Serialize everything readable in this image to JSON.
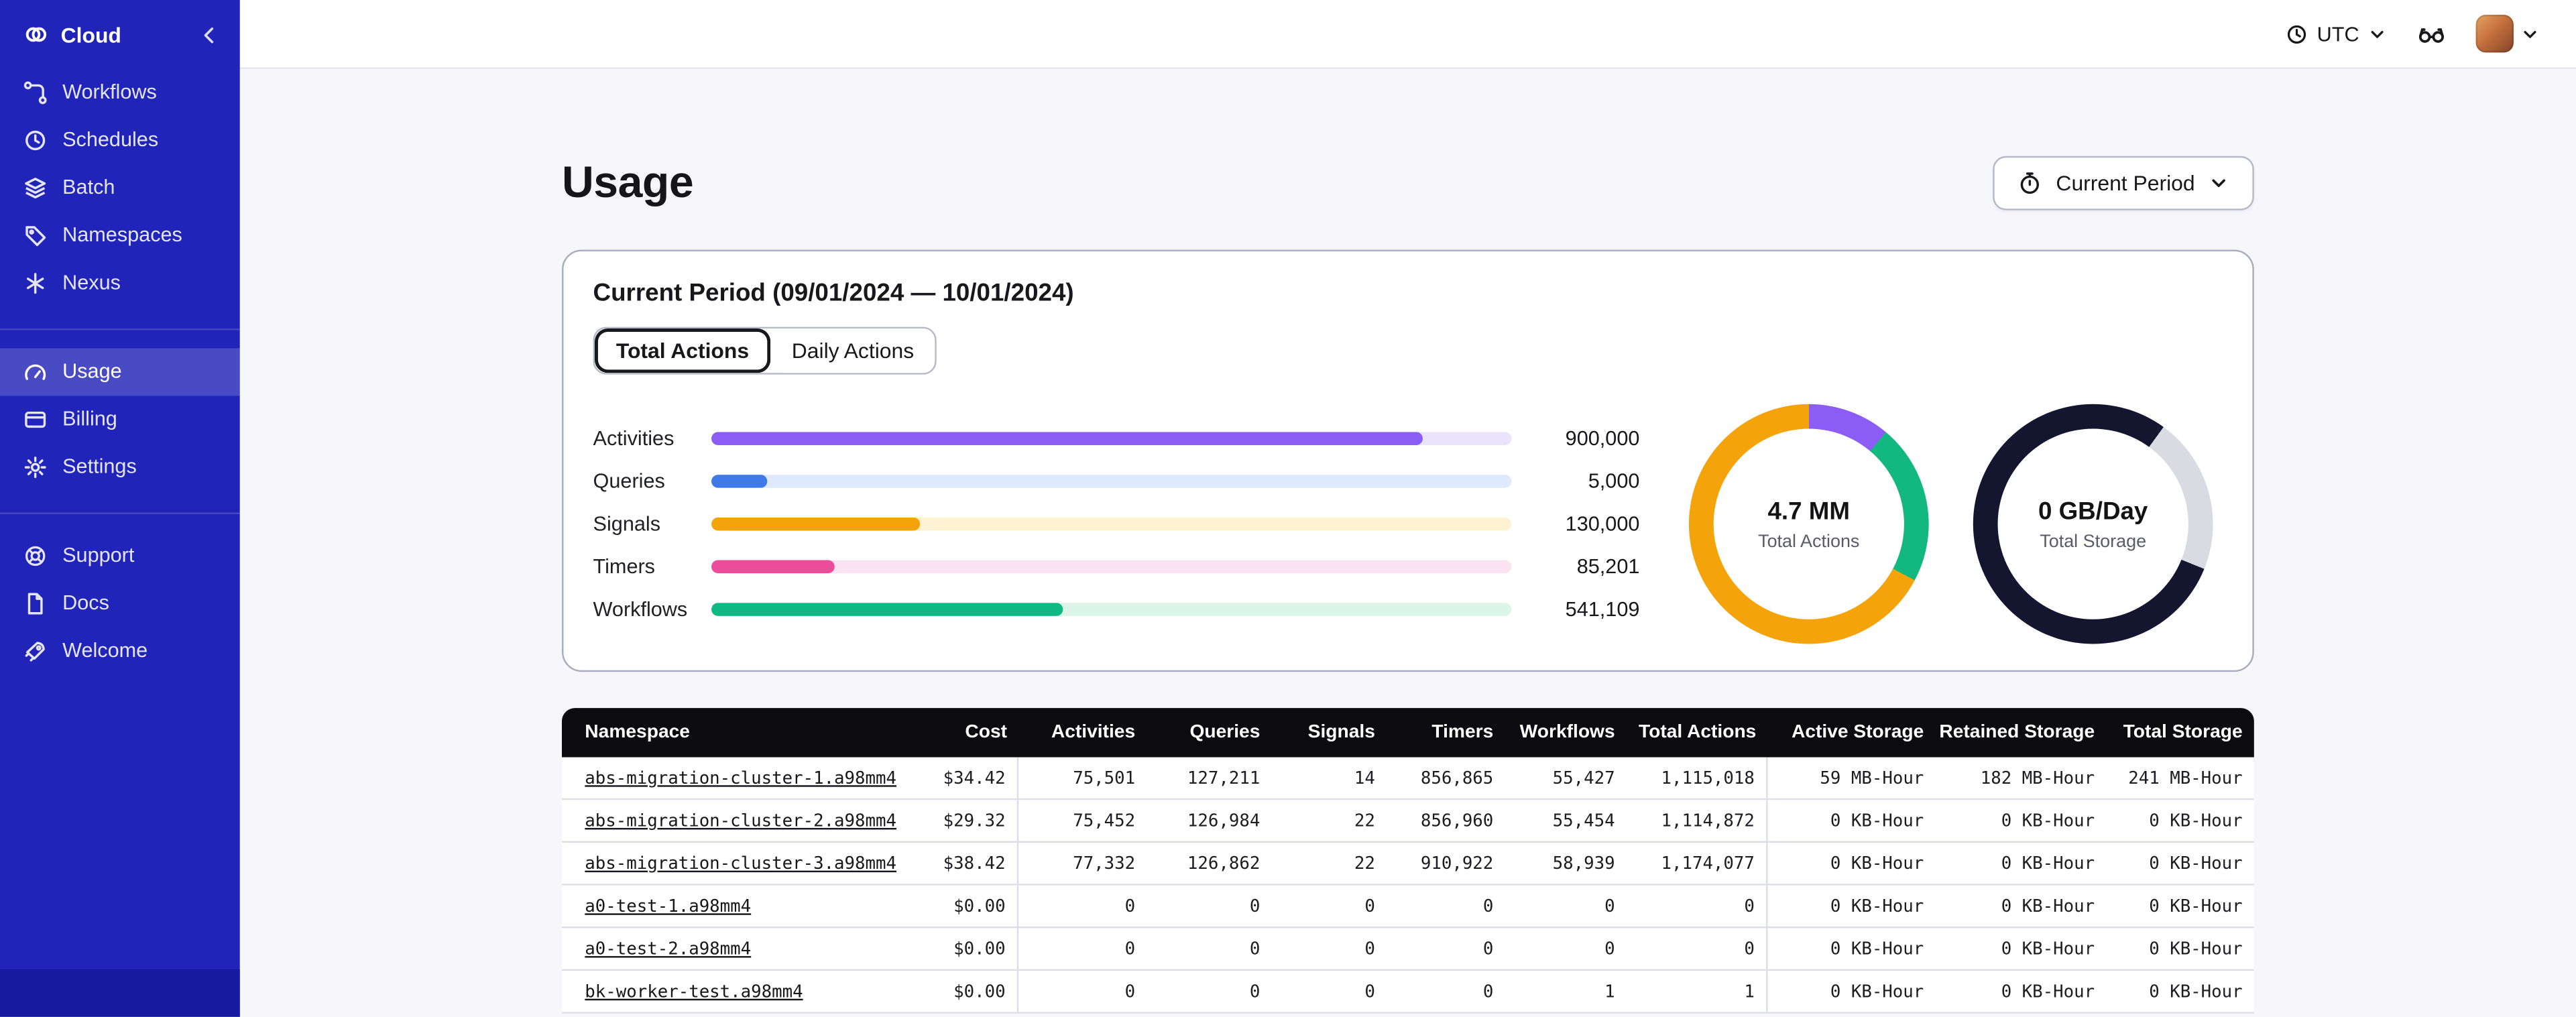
{
  "sidebar": {
    "brand": "Cloud",
    "sections": [
      {
        "items": [
          {
            "label": "Workflows"
          },
          {
            "label": "Schedules"
          },
          {
            "label": "Batch"
          },
          {
            "label": "Namespaces"
          },
          {
            "label": "Nexus"
          }
        ]
      },
      {
        "items": [
          {
            "label": "Usage",
            "active": true
          },
          {
            "label": "Billing"
          },
          {
            "label": "Settings"
          }
        ]
      },
      {
        "items": [
          {
            "label": "Support"
          },
          {
            "label": "Docs"
          },
          {
            "label": "Welcome"
          }
        ]
      }
    ]
  },
  "topbar": {
    "timezone": "UTC"
  },
  "page": {
    "title": "Usage",
    "period_selector": "Current Period"
  },
  "usage_card": {
    "title": "Current Period (09/01/2024 — 10/01/2024)",
    "tabs": [
      {
        "label": "Total Actions",
        "active": true
      },
      {
        "label": "Daily Actions",
        "active": false
      }
    ]
  },
  "chart_data": [
    {
      "type": "bar",
      "orientation": "horizontal",
      "title": "Current Period (09/01/2024 — 10/01/2024)",
      "categories": [
        "Activities",
        "Queries",
        "Signals",
        "Timers",
        "Workflows"
      ],
      "values": [
        900000,
        5000,
        130000,
        85201,
        541109
      ],
      "value_labels": [
        "900,000",
        "5,000",
        "130,000",
        "85,201",
        "541,109"
      ],
      "bar_percents": [
        89,
        7,
        26,
        15.5,
        44
      ],
      "fills": [
        "#8b5cf6",
        "#3f7ae8",
        "#f5a30b",
        "#ec4d9b",
        "#10b981"
      ],
      "tracks": [
        "#e9e4fb",
        "#dfe9fc",
        "#fdf3d3",
        "#fce3f1",
        "#dcf5e9"
      ]
    },
    {
      "type": "pie",
      "center_label": "4.7 MM",
      "center_sublabel": "Total Actions",
      "segments": [
        {
          "name": "purple",
          "color": "#8b5cf6",
          "from": 0,
          "to": 40
        },
        {
          "name": "green",
          "color": "#12b87f",
          "from": 40,
          "to": 118
        },
        {
          "name": "orange",
          "color": "#f5a30b",
          "from": 118,
          "to": 360
        }
      ]
    },
    {
      "type": "pie",
      "center_label": "0 GB/Day",
      "center_sublabel": "Total Storage",
      "segments": [
        {
          "name": "dark",
          "color": "#14162f",
          "from": 0,
          "to": 36
        },
        {
          "name": "gray",
          "color": "#d9dbe2",
          "from": 36,
          "to": 112
        },
        {
          "name": "dark",
          "color": "#14162f",
          "from": 112,
          "to": 360
        }
      ]
    }
  ],
  "table": {
    "columns": [
      "Namespace",
      "Cost",
      "Activities",
      "Queries",
      "Signals",
      "Timers",
      "Workflows",
      "Total Actions",
      "Active Storage",
      "Retained Storage",
      "Total Storage"
    ],
    "rows": [
      [
        "abs-migration-cluster-1.a98mm4",
        "$34.42",
        "75,501",
        "127,211",
        "14",
        "856,865",
        "55,427",
        "1,115,018",
        "59 MB-Hour",
        "182 MB-Hour",
        "241 MB-Hour"
      ],
      [
        "abs-migration-cluster-2.a98mm4",
        "$29.32",
        "75,452",
        "126,984",
        "22",
        "856,960",
        "55,454",
        "1,114,872",
        "0 KB-Hour",
        "0 KB-Hour",
        "0 KB-Hour"
      ],
      [
        "abs-migration-cluster-3.a98mm4",
        "$38.42",
        "77,332",
        "126,862",
        "22",
        "910,922",
        "58,939",
        "1,174,077",
        "0 KB-Hour",
        "0 KB-Hour",
        "0 KB-Hour"
      ],
      [
        "a0-test-1.a98mm4",
        "$0.00",
        "0",
        "0",
        "0",
        "0",
        "0",
        "0",
        "0 KB-Hour",
        "0 KB-Hour",
        "0 KB-Hour"
      ],
      [
        "a0-test-2.a98mm4",
        "$0.00",
        "0",
        "0",
        "0",
        "0",
        "0",
        "0",
        "0 KB-Hour",
        "0 KB-Hour",
        "0 KB-Hour"
      ],
      [
        "bk-worker-test.a98mm4",
        "$0.00",
        "0",
        "0",
        "0",
        "0",
        "1",
        "1",
        "0 KB-Hour",
        "0 KB-Hour",
        "0 KB-Hour"
      ]
    ]
  }
}
